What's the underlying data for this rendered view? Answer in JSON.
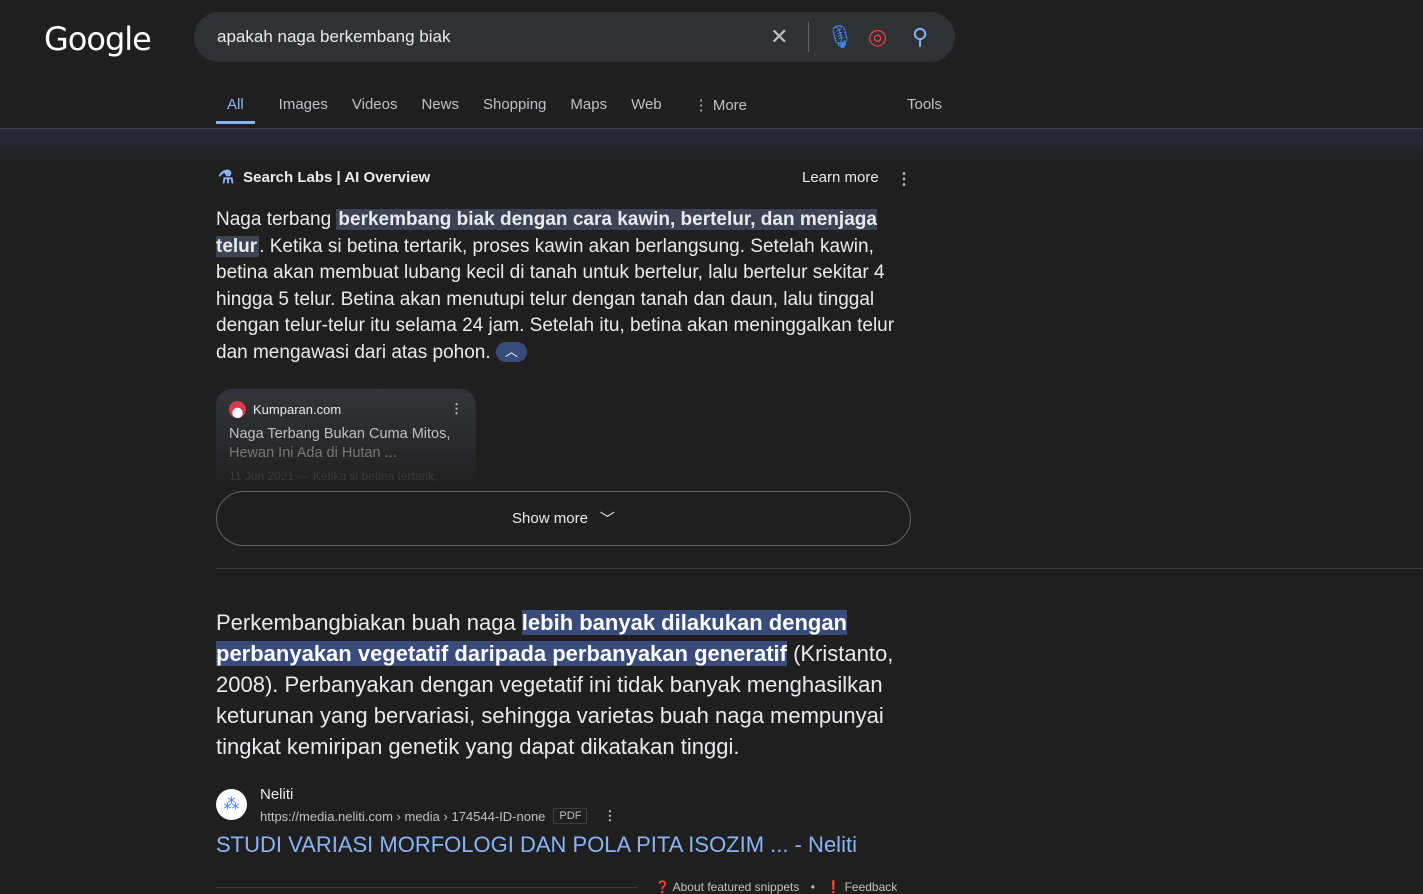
{
  "logo": "Google",
  "search": {
    "query": "apakah naga berkembang biak"
  },
  "tabs": [
    "All",
    "Images",
    "Videos",
    "News",
    "Shopping",
    "Maps",
    "Web",
    "More"
  ],
  "tools": "Tools",
  "ai_overview": {
    "header": "Search Labs | AI Overview",
    "learn_more": "Learn more",
    "text_pre": "Naga terbang ",
    "text_highlight": "berkembang biak dengan cara kawin, bertelur, dan menjaga telur",
    "text_post": ". Ketika si betina tertarik, proses kawin akan berlangsung. Setelah kawin, betina akan membuat lubang kecil di tanah untuk bertelur, lalu bertelur sekitar 4 hingga 5 telur. Betina akan menutupi telur dengan tanah dan daun, lalu tinggal dengan telur-telur itu selama 24 jam. Setelah itu, betina akan meninggalkan telur dan mengawasi dari atas pohon.",
    "source_card": {
      "site": "Kumparan.com",
      "title1": "Naga Terbang Bukan Cuma Mitos,",
      "title2": "Hewan Ini Ada di Hutan ...",
      "date": "11 Jun 2021 — Ketika si betina tertarik,"
    },
    "show_more": "Show more"
  },
  "snippet": {
    "pre": "Perkembangbiakan buah naga ",
    "highlight": "lebih banyak dilakukan dengan perbanyakan vegetatif daripada perbanyakan generatif",
    "post": " (Kristanto, 2008). Perbanyakan dengan vegetatif ini tidak banyak menghasilkan keturunan yang bervariasi, sehingga varietas buah naga mempunyai tingkat kemiripan genetik yang dapat dikatakan tinggi.",
    "source_name": "Neliti",
    "source_url": "https://media.neliti.com › media › 174544-ID-none",
    "badge": "PDF",
    "title": "STUDI VARIASI MORFOLOGI DAN POLA PITA ISOZIM ... - Neliti"
  },
  "footer": {
    "about": "About featured snippets",
    "dot": "•",
    "feedback": "Feedback"
  }
}
